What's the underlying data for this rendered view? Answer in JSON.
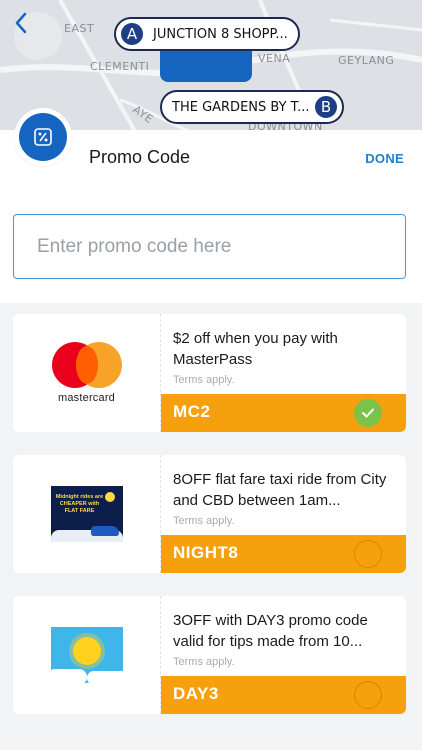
{
  "map": {
    "labels": [
      "JUNCTION 8 SHOPP...",
      "THE GARDENS BY T...",
      "EAST",
      "CLEMENTI",
      "VENA",
      "GEYLANG",
      "AYE",
      "DOWNTOWN"
    ],
    "pin_a": {
      "letter": "A",
      "text": "JUNCTION 8 SHOPP..."
    },
    "pin_b": {
      "letter": "B",
      "text": "THE GARDENS BY T..."
    },
    "back_icon": "chevron-left-icon",
    "accent": "#1565c0"
  },
  "header": {
    "title": "Promo Code",
    "done_label": "DONE",
    "badge_icon": "percent-icon"
  },
  "input": {
    "placeholder": "Enter promo code here",
    "value": ""
  },
  "promos": [
    {
      "logo": "mastercard",
      "logo_text": "mastercard",
      "description": "$2 off when you pay with MasterPass",
      "terms": "Terms apply.",
      "code": "MC2",
      "selected": true
    },
    {
      "logo": "night-banner",
      "logo_text": "Midnight rides are CHEAPER with FLAT FARE",
      "description": "8OFF flat fare taxi ride from City and CBD between 1am...",
      "terms": "Terms apply.",
      "code": "NIGHT8",
      "selected": false
    },
    {
      "logo": "sun-banner",
      "logo_text": "",
      "description": "3OFF with DAY3 promo code valid for tips made from 10...",
      "terms": "Terms apply.",
      "code": "DAY3",
      "selected": false
    }
  ],
  "colors": {
    "code_bar": "#f7a00d",
    "selected_check": "#7bc24a",
    "done": "#1f7fd0",
    "input_border": "#3f9be0"
  }
}
